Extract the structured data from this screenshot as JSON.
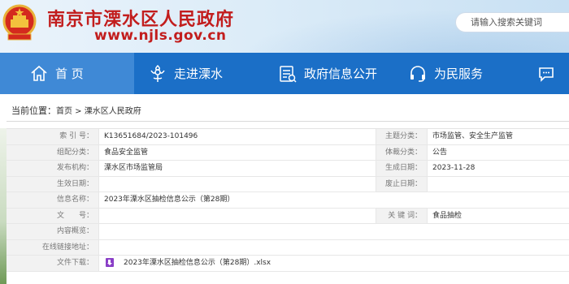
{
  "header": {
    "title": "南京市溧水区人民政府",
    "url": "www.njls.gov.cn",
    "search_placeholder": "请输入搜索关键词"
  },
  "nav": {
    "items": [
      {
        "label": "首 页",
        "icon": "home-icon"
      },
      {
        "label": "走进溧水",
        "icon": "flower-icon"
      },
      {
        "label": "政府信息公开",
        "icon": "document-icon"
      },
      {
        "label": "为民服务",
        "icon": "headset-icon"
      },
      {
        "label": "",
        "icon": "chat-icon"
      }
    ]
  },
  "breadcrumb": {
    "current_label": "当前位置：",
    "home": "首页",
    "sep": " > ",
    "section": "溧水区人民政府"
  },
  "info": {
    "index_label": "索 引 号：",
    "index_value": "K13651684/2023-101496",
    "topic_label": "主题分类：",
    "topic_value": "市场监管、安全生产监管",
    "org_label": "组配分类：",
    "org_value": "食品安全监管",
    "genre_label": "体裁分类：",
    "genre_value": "公告",
    "publisher_label": "发布机构：",
    "publisher_value": "溧水区市场监管局",
    "created_label": "生成日期：",
    "created_value": "2023-11-28",
    "effective_label": "生效日期：",
    "effective_value": "",
    "abolish_label": "废止日期：",
    "abolish_value": "",
    "name_label": "信息名称：",
    "name_value": "2023年溧水区抽检信息公示（第28期）",
    "docno_label": "文　　号：",
    "docno_value": "",
    "keyword_label": "关 键 词：",
    "keyword_value": "食品抽检",
    "summary_label": "内容概览：",
    "summary_value": "",
    "online_label": "在线链接地址：",
    "online_value": "",
    "download_label": "文件下载：",
    "download_value": "2023年溧水区抽检信息公示（第28期）.xlsx"
  },
  "colors": {
    "title_red": "#c21d1d",
    "nav_blue": "#1b6fc7",
    "nav_active": "#3f89d6"
  }
}
